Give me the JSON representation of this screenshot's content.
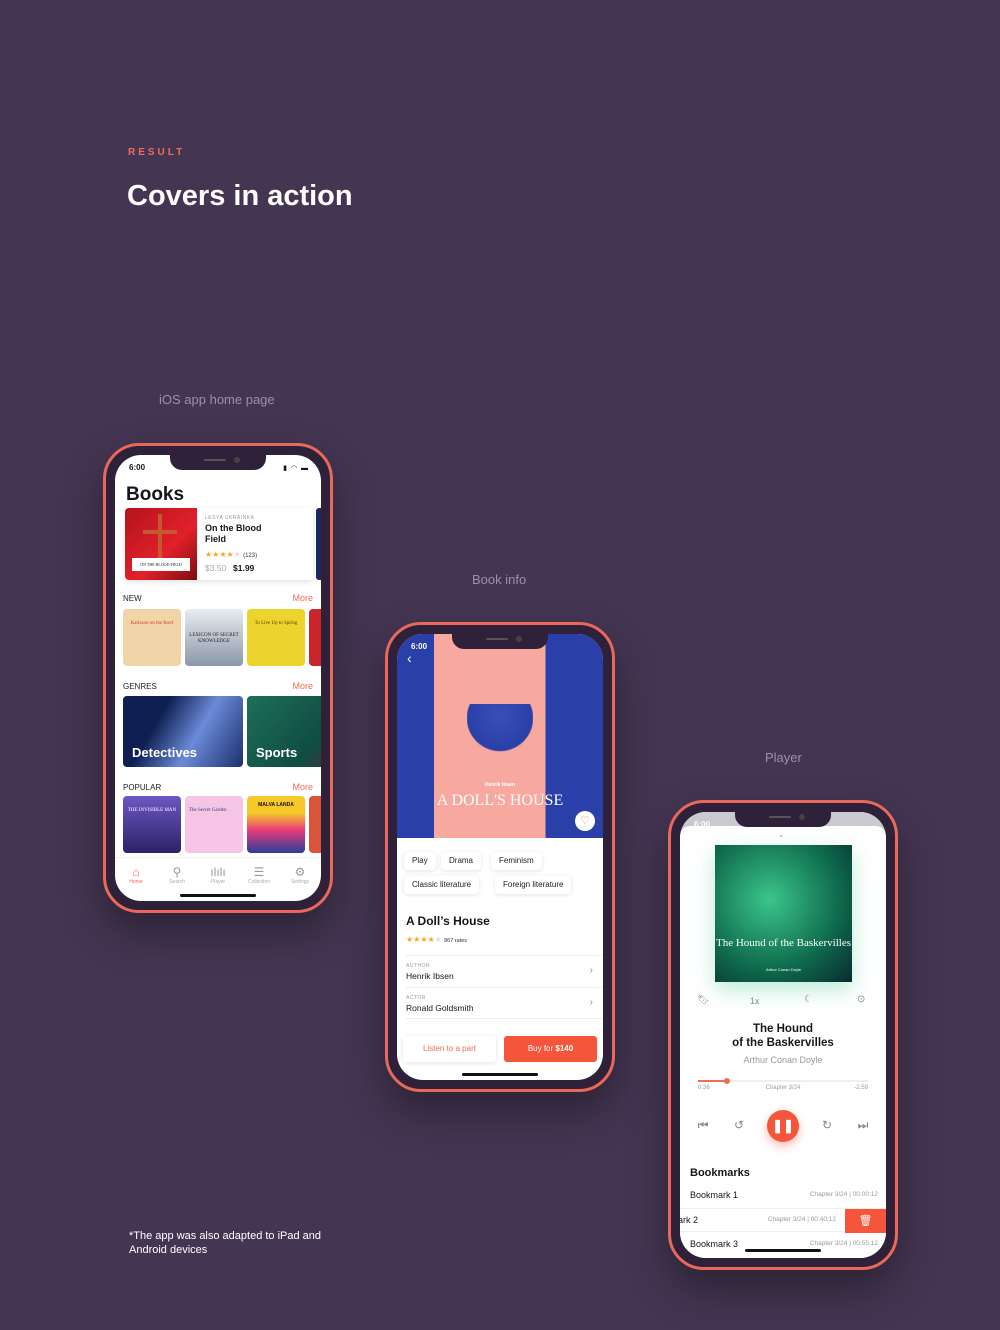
{
  "header": {
    "eyebrow": "RESULT",
    "title": "Covers in action"
  },
  "captions": {
    "home": "iOS app home page",
    "book_info": "Book info",
    "player": "Player"
  },
  "footnote": "*The app was also adapted to iPad and Android devices",
  "status": {
    "time": "6:00",
    "icons": "signal wifi battery"
  },
  "home": {
    "title": "Books",
    "featured": {
      "cover_text": "ON THE BLOOD FIELD",
      "author": "LESYA UKRAINKA",
      "title": "On the Blood Field",
      "stars": 4,
      "rating_count": "(123)",
      "old_price": "$3.50",
      "price": "$1.99"
    },
    "more": "More",
    "new": {
      "label": "NEW",
      "covers": [
        "Karlsson on the Roof",
        "LEXICON OF SECRET KNOWLEDGE",
        "To Live Up to Spring",
        ""
      ]
    },
    "genres": {
      "label": "GENRES",
      "items": [
        "Detectives",
        "Sports"
      ]
    },
    "popular": {
      "label": "POPULAR",
      "covers": [
        "THE INVISIBLE MAN",
        "The Secret Garden",
        "MALVA LANDA",
        ""
      ]
    },
    "tabs": [
      {
        "label": "Home",
        "icon": "home-icon"
      },
      {
        "label": "Search",
        "icon": "search-icon"
      },
      {
        "label": "Player",
        "icon": "waveform-icon"
      },
      {
        "label": "Collection",
        "icon": "collection-icon"
      },
      {
        "label": "Settings",
        "icon": "gear-icon"
      }
    ]
  },
  "book": {
    "cover_author": "Henrik Ibsen",
    "cover_title": "A DOLL'S HOUSE",
    "tags": [
      "Play",
      "Drama",
      "Feminism",
      "Classic literature",
      "Foreign literature"
    ],
    "title": "A Doll’s House",
    "stars": 4,
    "rates": "867 rates",
    "author_label": "AUTHOR",
    "author": "Henrik Ibsen",
    "actor_label": "ACTOR",
    "actor": "Ronald Goldsmith",
    "listen": "Listen to a part",
    "buy_prefix": "Buy for ",
    "buy_price": "$140"
  },
  "player": {
    "cover_title": "The Hound of the Baskervilles",
    "cover_author": "Arthur Conan Doyle",
    "speed": "1x",
    "title_line1": "The Hound",
    "title_line2": "of the Baskervilles",
    "author": "Arthur Conan Doyle",
    "elapsed": "0:36",
    "chapter": "Chapter 3/24",
    "remaining": "-2:59",
    "progress": 0.17,
    "bookmarks_title": "Bookmarks",
    "bookmarks": [
      {
        "name": "Bookmark 1",
        "detail": "Chapter 3/24 | 00:00:12"
      },
      {
        "name": "ark 2",
        "detail": "Chapter 3/24 | 00:40:12"
      },
      {
        "name": "Bookmark 3",
        "detail": "Chapter 3/24 | 00:55:12"
      }
    ]
  },
  "colors": {
    "background": "#443552",
    "accent": "#f26b55",
    "frame": "#e8685b",
    "star": "#f5a623"
  }
}
